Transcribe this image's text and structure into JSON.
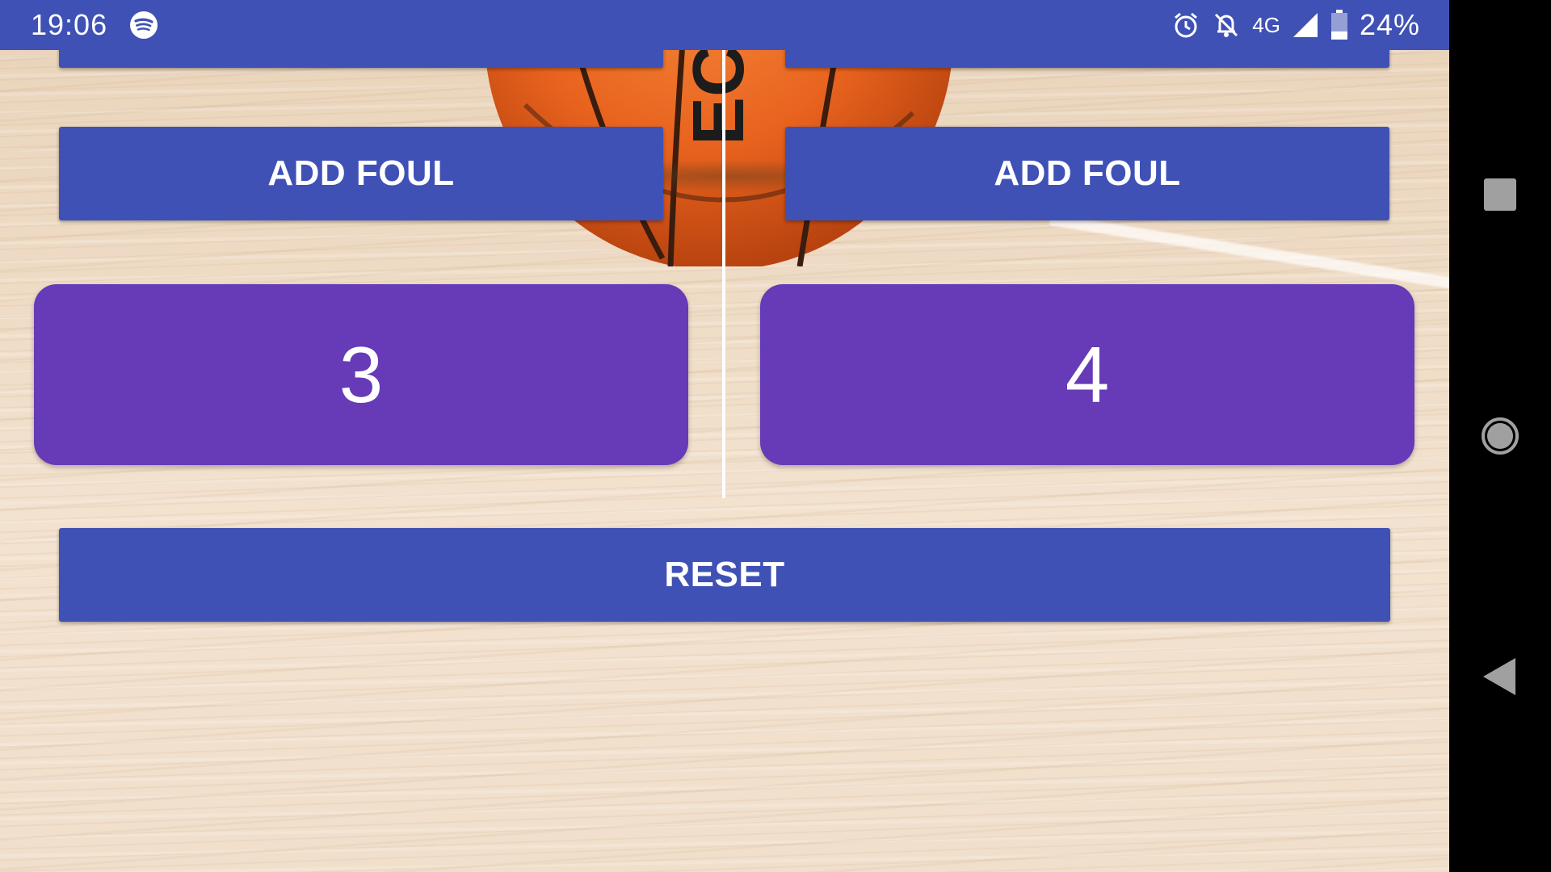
{
  "status_bar": {
    "time": "19:06",
    "network": "4G",
    "battery": "24%",
    "icons": [
      "spotify-icon",
      "alarm-icon",
      "notifications-off-icon",
      "signal-icon",
      "battery-icon"
    ]
  },
  "team_a": {
    "foul_label": "ADD FOUL",
    "score": "3"
  },
  "team_b": {
    "foul_label": "ADD FOUL",
    "score": "4"
  },
  "reset_label": "RESET",
  "nav": {
    "icons": [
      "recents-icon",
      "home-icon",
      "back-icon"
    ]
  },
  "colors": {
    "primary": "#3f51b5",
    "score_bg": "#673ab7",
    "ball": "#e8621e"
  }
}
